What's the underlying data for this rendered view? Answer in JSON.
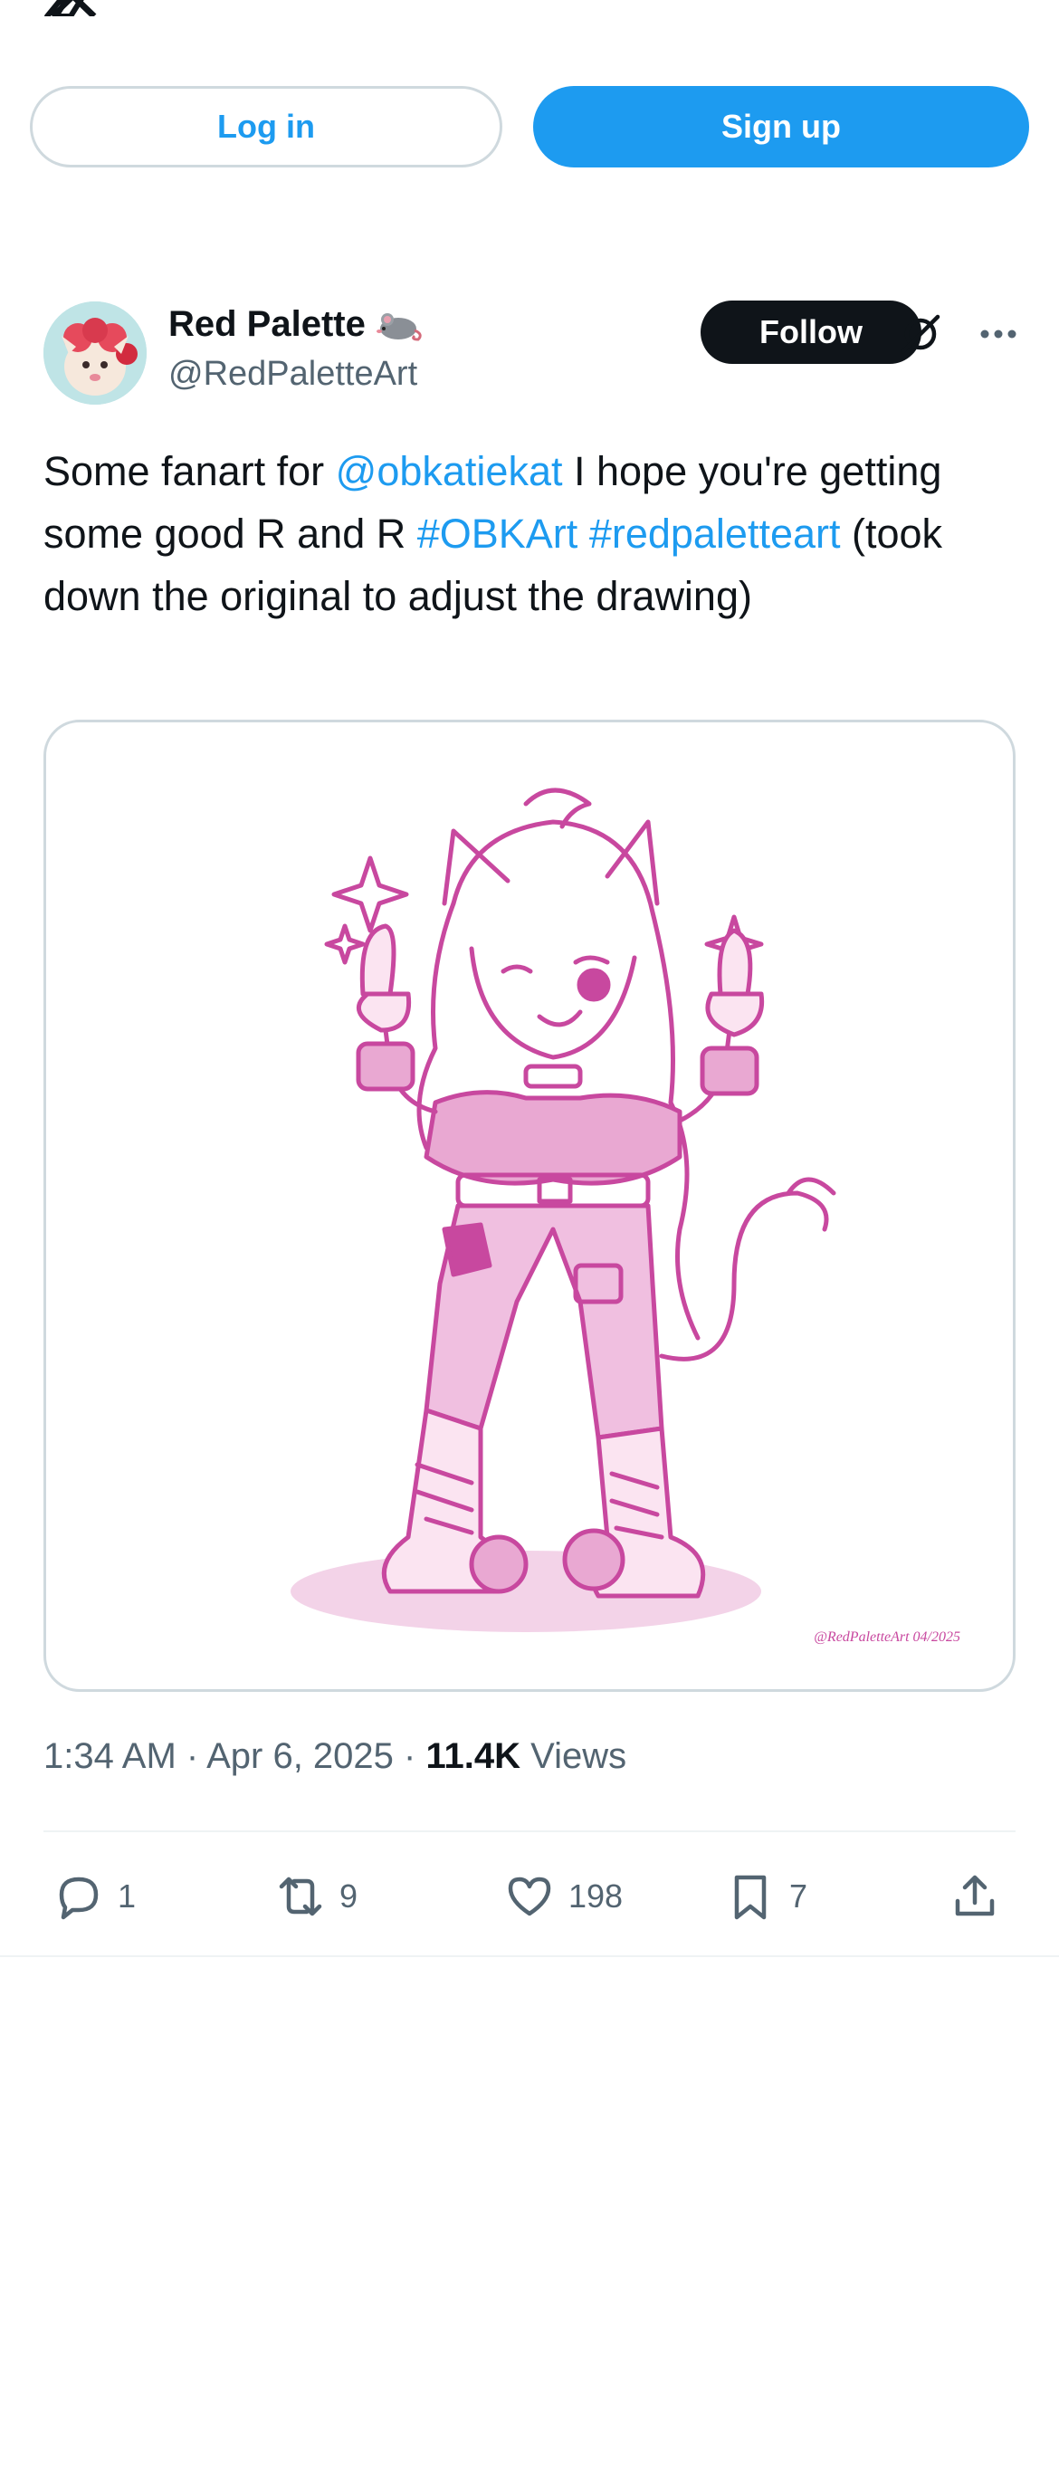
{
  "auth": {
    "login_label": "Log in",
    "signup_label": "Sign up"
  },
  "tweet": {
    "author": {
      "display_name": "Red Palette",
      "handle": "@RedPaletteArt",
      "follow_label": "Follow"
    },
    "text_parts": {
      "p1": "Some fanart for ",
      "mention": "@obkatiekat",
      "p2": " I hope you're getting some good R and R ",
      "hashtag1": "#OBKArt",
      "hashtag2": "#redpaletteart",
      "p3": " (took down the original to adjust the drawing)"
    },
    "media": {
      "signature": "@RedPaletteArt 04/2025"
    },
    "meta": {
      "time": "1:34 AM · Apr 6, 2025 · ",
      "views_count": "11.4K",
      "views_label": "Views"
    },
    "actions": {
      "replies": "1",
      "reposts": "9",
      "likes": "198",
      "bookmarks": "7"
    }
  },
  "colors": {
    "accent": "#1d9bf0",
    "text_primary": "#0f1419",
    "text_secondary": "#536471",
    "border": "#cfd9de",
    "art_pink": "#c8489f"
  },
  "icons": {
    "logo": "x-logo-icon",
    "grok": "grok-icon",
    "more": "more-dots-icon",
    "reply": "reply-icon",
    "repost": "repost-icon",
    "like": "heart-icon",
    "bookmark": "bookmark-icon",
    "share": "share-icon"
  }
}
